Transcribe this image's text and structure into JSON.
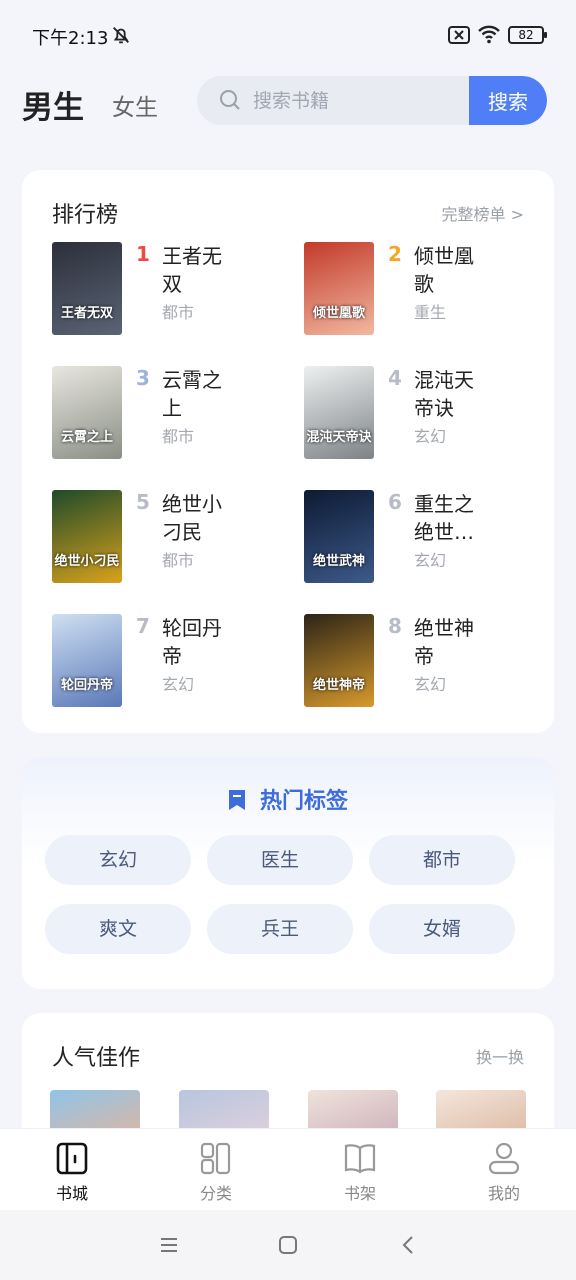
{
  "status_bar": {
    "time": "下午2:13",
    "battery": "82"
  },
  "header": {
    "tab_male": "男生",
    "tab_female": "女生",
    "search_placeholder": "搜索书籍",
    "search_button": "搜索"
  },
  "ranking": {
    "title": "排行榜",
    "more": "完整榜单 >",
    "items": [
      {
        "rank": "1",
        "title": "王者无双",
        "genre": "都市",
        "rank_color": "#f0493e",
        "cover_text": "王者无双",
        "cover_colors": [
          "#2b2f3a",
          "#5b6475"
        ]
      },
      {
        "rank": "2",
        "title": "倾世凰歌",
        "genre": "重生",
        "rank_color": "#f5a623",
        "cover_text": "倾世凰歌",
        "cover_colors": [
          "#c23a2a",
          "#f2b8a0"
        ]
      },
      {
        "rank": "3",
        "title": "云霄之上",
        "genre": "都市",
        "rank_color": "#9fb3d9",
        "cover_text": "云霄之上",
        "cover_colors": [
          "#e8e6df",
          "#8a8f86"
        ]
      },
      {
        "rank": "4",
        "title": "混沌天帝诀",
        "genre": "玄幻",
        "rank_color": "#b8bcc6",
        "cover_text": "混沌天帝诀",
        "cover_colors": [
          "#eef0f0",
          "#7c8286"
        ]
      },
      {
        "rank": "5",
        "title": "绝世小刁民",
        "genre": "都市",
        "rank_color": "#b8bcc6",
        "cover_text": "绝世小刁民",
        "cover_colors": [
          "#1f4a2a",
          "#d9a21b"
        ]
      },
      {
        "rank": "6",
        "title": "重生之绝世…",
        "genre": "玄幻",
        "rank_color": "#b8bcc6",
        "cover_text": "绝世武神",
        "cover_colors": [
          "#0d1a33",
          "#3d5a8a"
        ]
      },
      {
        "rank": "7",
        "title": "轮回丹帝",
        "genre": "玄幻",
        "rank_color": "#b8bcc6",
        "cover_text": "轮回丹帝",
        "cover_colors": [
          "#cfe0f2",
          "#5a78b8"
        ]
      },
      {
        "rank": "8",
        "title": "绝世神帝",
        "genre": "玄幻",
        "rank_color": "#b8bcc6",
        "cover_text": "绝世神帝",
        "cover_colors": [
          "#2c2418",
          "#d89a2c"
        ]
      }
    ]
  },
  "hot_tags": {
    "title": "热门标签",
    "tags": [
      "玄幻",
      "医生",
      "都市",
      "爽文",
      "兵王",
      "女婿"
    ]
  },
  "popular": {
    "title": "人气佳作",
    "refresh": "换一换",
    "cover_colors": [
      [
        "#8fc4e8",
        "#e7b49a"
      ],
      [
        "#b7c6dd",
        "#e6d1de"
      ],
      [
        "#efe3dc",
        "#c9a9b6"
      ],
      [
        "#f4e6dc",
        "#d9b39a"
      ]
    ]
  },
  "bottom_nav": {
    "items": [
      {
        "label": "书城",
        "icon": "bookstore-icon",
        "active": true
      },
      {
        "label": "分类",
        "icon": "category-icon",
        "active": false
      },
      {
        "label": "书架",
        "icon": "bookshelf-icon",
        "active": false
      },
      {
        "label": "我的",
        "icon": "profile-icon",
        "active": false
      }
    ]
  }
}
